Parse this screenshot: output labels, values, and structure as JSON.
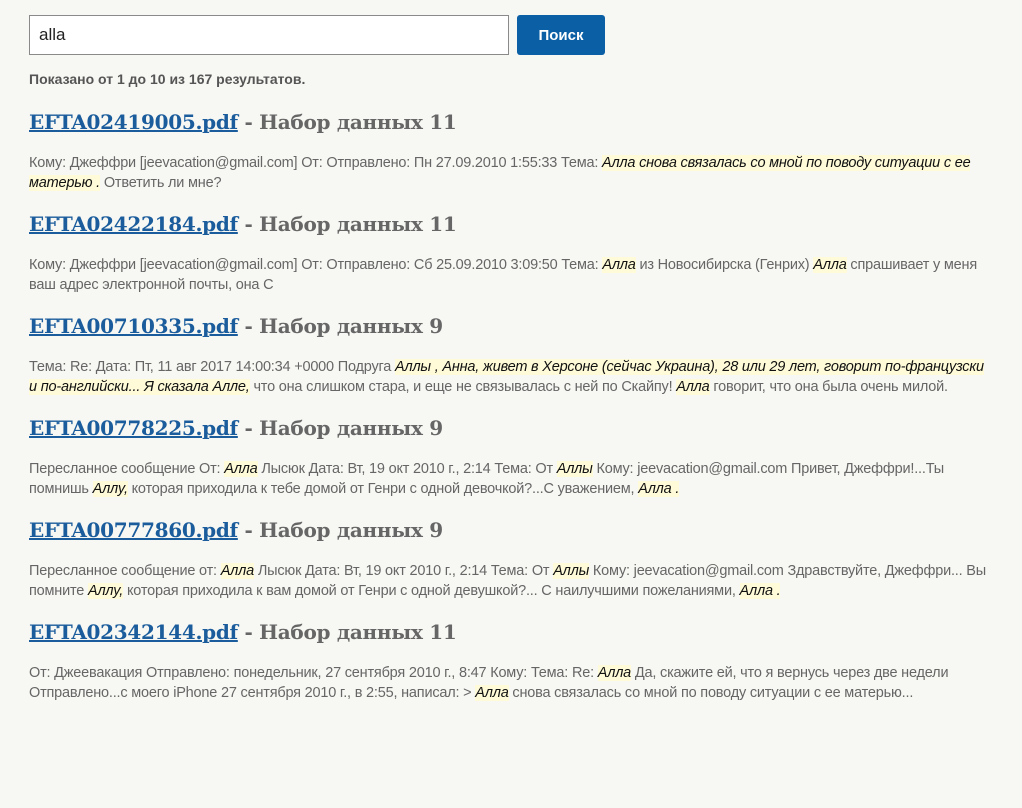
{
  "search": {
    "value": "alla",
    "button_label": "Поиск"
  },
  "summary": "Показано от 1 до 10 из 167 результатов.",
  "results": [
    {
      "file": "EFTA02419005.pdf",
      "dataset": " - Набор данных 11",
      "snippet": [
        {
          "t": "Кому: Джеффри [jeevacation@gmail.com] От: Отправлено: Пн 27.09.2010 1:55:33 Тема: "
        },
        {
          "t": "Алла снова связалась со мной по поводу ситуации с ее матерью .",
          "hl": true
        },
        {
          "t": " Ответить ли мне?"
        }
      ]
    },
    {
      "file": "EFTA02422184.pdf",
      "dataset": " - Набор данных 11",
      "snippet": [
        {
          "t": "Кому: Джеффри [jeevacation@gmail.com] От: Отправлено: Сб 25.09.2010 3:09:50 Тема: "
        },
        {
          "t": "Алла",
          "hl": true
        },
        {
          "t": " из Новосибирска (Генрих) "
        },
        {
          "t": "Алла",
          "hl": true
        },
        {
          "t": " спрашивает у меня ваш адрес электронной почты, она С"
        }
      ]
    },
    {
      "file": "EFTA00710335.pdf",
      "dataset": " - Набор данных 9",
      "snippet": [
        {
          "t": "Тема: Re: Дата: Пт, 11 авг 2017 14:00:34 +0000 Подруга "
        },
        {
          "t": "Аллы , Анна, живет в Херсоне (сейчас Украина), 28 или 29 лет, говорит по-французски и по-английски... Я сказала Алле,",
          "hl": true
        },
        {
          "t": " что она слишком стара, и еще не связывалась с ней по Скайпу! "
        },
        {
          "t": "Алла",
          "hl": true
        },
        {
          "t": " говорит, что она была очень милой."
        }
      ]
    },
    {
      "file": "EFTA00778225.pdf",
      "dataset": " - Набор данных 9",
      "snippet": [
        {
          "t": "Пересланное сообщение От: "
        },
        {
          "t": "Алла",
          "hl": true
        },
        {
          "t": " Лысюк Дата: Вт, 19 окт 2010 г., 2:14 Тема: От "
        },
        {
          "t": "Аллы",
          "hl": true
        },
        {
          "t": " Кому: jeevacation@gmail.com Привет, Джеффри!...Ты помнишь "
        },
        {
          "t": "Аллу,",
          "hl": true
        },
        {
          "t": " которая приходила к тебе домой от Генри с одной девочкой?...С уважением, "
        },
        {
          "t": "Алла .",
          "hl": true
        }
      ]
    },
    {
      "file": "EFTA00777860.pdf",
      "dataset": " - Набор данных 9",
      "snippet": [
        {
          "t": "Пересланное сообщение от: "
        },
        {
          "t": "Алла",
          "hl": true
        },
        {
          "t": " Лысюк Дата: Вт, 19 окт 2010 г., 2:14 Тема: От "
        },
        {
          "t": "Аллы",
          "hl": true
        },
        {
          "t": " Кому: jeevacation@gmail.com Здравствуйте, Джеффри... Вы помните "
        },
        {
          "t": "Аллу,",
          "hl": true
        },
        {
          "t": " которая приходила к вам домой от Генри с одной девушкой?... С наилучшими пожеланиями, "
        },
        {
          "t": "Алла .",
          "hl": true
        }
      ]
    },
    {
      "file": "EFTA02342144.pdf",
      "dataset": " - Набор данных 11",
      "snippet": [
        {
          "t": "От: Джеевакация Отправлено: понедельник, 27 сентября 2010 г., 8:47 Кому: Тема: Re: "
        },
        {
          "t": "Алла",
          "hl": true
        },
        {
          "t": " Да, скажите ей, что я вернусь через две недели Отправлено...с моего iPhone 27 сентября 2010 г., в 2:55, написал: > "
        },
        {
          "t": "Алла",
          "hl": true
        },
        {
          "t": " снова связалась со мной по поводу ситуации с ее матерью..."
        }
      ]
    }
  ]
}
